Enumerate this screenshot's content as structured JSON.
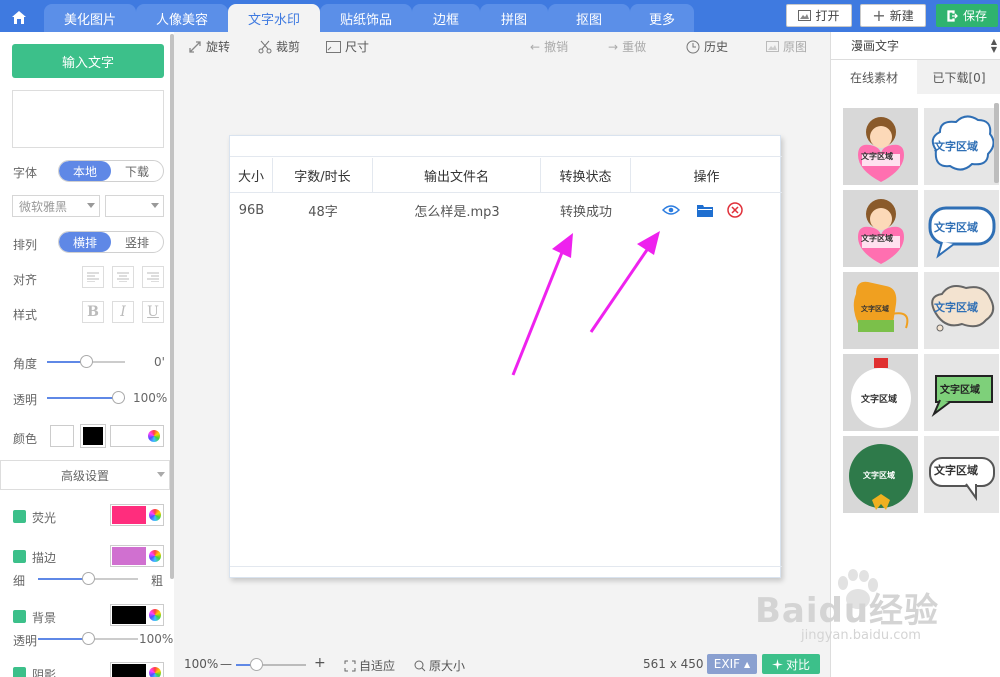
{
  "topbar": {
    "tabs": [
      "美化图片",
      "人像美容",
      "文字水印",
      "贴纸饰品",
      "边框",
      "拼图",
      "抠图",
      "更多"
    ],
    "active_tab": "文字水印",
    "open_label": "打开",
    "new_label": "新建",
    "save_label": "保存"
  },
  "left": {
    "input_text_label": "输入文字",
    "font_label": "字体",
    "font_source": [
      "本地",
      "下载"
    ],
    "font_name": "微软雅黑",
    "arrange_label": "排列",
    "arrange_options": [
      "横排",
      "竖排"
    ],
    "align_label": "对齐",
    "style_label": "样式",
    "style_buttons": [
      "B",
      "I",
      "U"
    ],
    "angle_label": "角度",
    "angle_value": "0'",
    "angle_level": 0.5,
    "opacity_label": "透明",
    "opacity_value": "100%",
    "opacity_level": 1.0,
    "color_label": "颜色",
    "advanced_label": "高级设置",
    "glow_label": "荧光",
    "stroke_label": "描边",
    "thin_label": "细",
    "thick_label": "粗",
    "stroke_level": 0.5,
    "background_label": "背景",
    "bg_opacity_label": "透明",
    "bg_opacity_value": "100%",
    "bg_opacity_level": 0.5,
    "shadow_label": "阴影"
  },
  "colors": {
    "accent": "#3f7ae0",
    "green": "#3cc08a",
    "glow": "#ff2d7d",
    "stroke": "#d070d0",
    "background": "#000000",
    "arrow": "#ee22ee"
  },
  "toolbar": {
    "rotate": "旋转",
    "crop": "裁剪",
    "size": "尺寸",
    "undo": "撤销",
    "redo": "重做",
    "history": "历史",
    "original": "原图"
  },
  "table": {
    "headers": [
      "大小",
      "字数/时长",
      "输出文件名",
      "转换状态",
      "操作"
    ],
    "row": {
      "size": "96B",
      "count": "48字",
      "filename": "怎么样是.mp3",
      "status": "转换成功"
    }
  },
  "bottombar": {
    "zoom": "100%",
    "minus": "—",
    "plus": "+",
    "fit": "自适应",
    "original_size": "原大小",
    "dimensions": "561 x 450",
    "exif": "EXIF",
    "compare": "对比"
  },
  "right": {
    "category": "漫画文字",
    "tab_online": "在线素材",
    "tab_downloaded": "已下载[0]",
    "sticker_text": "文字区域"
  },
  "watermark": {
    "brand": "Baidu经验",
    "url": "jingyan.baidu.com"
  }
}
